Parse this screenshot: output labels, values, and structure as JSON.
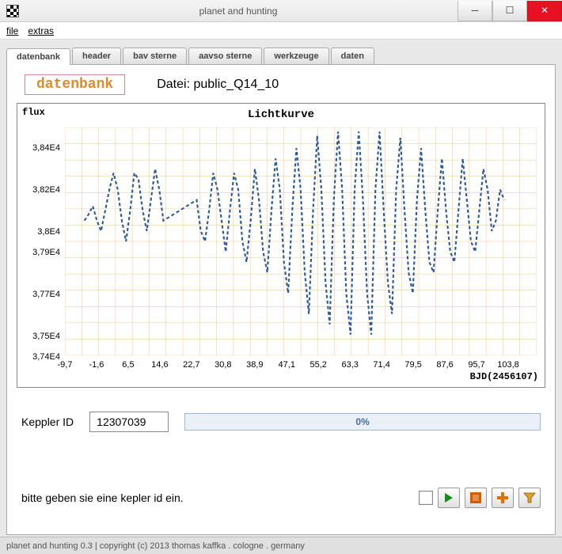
{
  "window": {
    "title": "planet and hunting"
  },
  "menubar": {
    "file": "file",
    "extras": "extras"
  },
  "tabs": {
    "datenbank": "datenbank",
    "header": "header",
    "bav": "bav sterne",
    "aavso": "aavso sterne",
    "werkzeuge": "werkzeuge",
    "daten": "daten"
  },
  "panel": {
    "badge": "datenbank",
    "datei_label": "Datei: public_Q14_10",
    "kepler_label": "Keppler ID",
    "kepler_value": "12307039",
    "progress_text": "0%",
    "hint": "bitte geben sie eine kepler id ein."
  },
  "statusbar": {
    "text": "planet and hunting 0.3 | copyright (c) 2013 thomas kaffka . cologne . germany"
  },
  "chart_data": {
    "type": "line",
    "title": "Lichtkurve",
    "ylabel": "flux",
    "xlabel": "BJD(2456107)",
    "xlim": [
      -9.7,
      103.8
    ],
    "ylim": [
      37400,
      38500
    ],
    "x_ticks": [
      "-9,7",
      "-1,6",
      "6,5",
      "14,6",
      "22,7",
      "30,8",
      "38,9",
      "47,1",
      "55,2",
      "63,3",
      "71,4",
      "79,5",
      "87,6",
      "95,7",
      "103,8"
    ],
    "y_ticks": [
      "3,84E4",
      "3,82E4",
      "3,8E4",
      "3,79E4",
      "3,77E4",
      "3,75E4",
      "3,74E4"
    ],
    "series": [
      {
        "name": "flux",
        "x": [
          -5,
          -4,
          -3,
          -2,
          -1,
          0,
          1,
          2,
          3,
          4,
          5,
          6,
          7,
          8,
          9,
          10,
          11,
          12,
          13,
          14,
          22,
          23,
          24,
          25,
          26,
          27,
          28,
          29,
          30,
          31,
          32,
          33,
          34,
          35,
          36,
          37,
          38,
          39,
          40,
          41,
          42,
          43,
          44,
          45,
          46,
          47,
          48,
          49,
          50,
          51,
          52,
          53,
          54,
          55,
          56,
          57,
          58,
          59,
          60,
          61,
          62,
          63,
          64,
          65,
          66,
          67,
          68,
          69,
          70,
          71,
          72,
          73,
          74,
          75,
          76,
          77,
          78,
          79,
          80,
          81,
          82,
          83,
          84,
          85,
          86,
          87,
          88,
          89,
          90,
          91,
          92,
          93,
          94,
          95,
          96
        ],
        "y": [
          38050,
          38080,
          38120,
          38050,
          38000,
          38100,
          38200,
          38280,
          38200,
          38050,
          37950,
          38100,
          38280,
          38250,
          38100,
          38000,
          38150,
          38300,
          38200,
          38050,
          38150,
          38000,
          37950,
          38100,
          38280,
          38200,
          38050,
          37900,
          38100,
          38280,
          38200,
          37950,
          37850,
          38050,
          38300,
          38150,
          37900,
          37800,
          38100,
          38350,
          38200,
          37850,
          37700,
          38100,
          38400,
          38200,
          37800,
          37600,
          38100,
          38460,
          38200,
          37750,
          37550,
          38150,
          38480,
          38200,
          37700,
          37500,
          38200,
          38480,
          38150,
          37700,
          37500,
          38200,
          38480,
          38100,
          37750,
          37600,
          38200,
          38450,
          38100,
          37800,
          37700,
          38150,
          38400,
          38100,
          37850,
          37800,
          38100,
          38350,
          38100,
          37900,
          37850,
          38100,
          38350,
          38150,
          37950,
          37900,
          38100,
          38300,
          38200,
          38000,
          38050,
          38200,
          38150
        ]
      }
    ]
  }
}
